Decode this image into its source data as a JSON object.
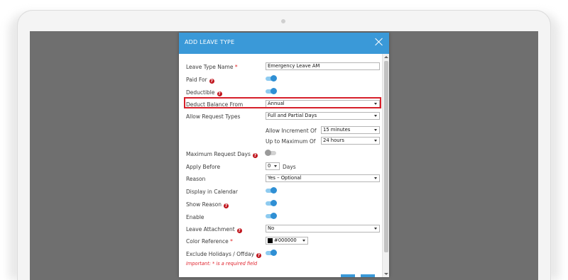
{
  "modal": {
    "title": "ADD LEAVE TYPE"
  },
  "fields": {
    "leave_type_name": {
      "label": "Leave Type Name",
      "required_mark": "*",
      "value": "Emergency Leave AM"
    },
    "paid_for": {
      "label": "Paid For",
      "on": true
    },
    "deductible": {
      "label": "Deductible",
      "on": true
    },
    "deduct_balance_from": {
      "label": "Deduct Balance From",
      "value": "Annual"
    },
    "allow_request_types": {
      "label": "Allow Request Types",
      "value": "Full and Partial Days"
    },
    "allow_increment_of": {
      "label": "Allow Increment Of",
      "value": "15 minutes"
    },
    "up_to_maximum_of": {
      "label": "Up to Maximum Of",
      "value": "24 hours"
    },
    "maximum_request_days": {
      "label": "Maximum Request Days",
      "on": false
    },
    "apply_before": {
      "label": "Apply Before",
      "value": "0",
      "unit": "Days"
    },
    "reason": {
      "label": "Reason",
      "value": "Yes – Optional"
    },
    "display_in_calendar": {
      "label": "Display in Calendar",
      "on": true
    },
    "show_reason": {
      "label": "Show Reason",
      "on": true
    },
    "enable": {
      "label": "Enable",
      "on": true
    },
    "leave_attachment": {
      "label": "Leave Attachment",
      "value": "No"
    },
    "color_reference": {
      "label": "Color Reference",
      "required_mark": "*",
      "value": "#000000",
      "swatch": "#000000"
    },
    "exclude_holidays": {
      "label": "Exclude Holidays / Offday",
      "on": true
    }
  },
  "note": "Important: * is a required field",
  "colors": {
    "header": "#3a99d8",
    "highlight": "#d6202a",
    "toggle_on": "#2f8fd4",
    "help_icon": "#c0141c"
  }
}
